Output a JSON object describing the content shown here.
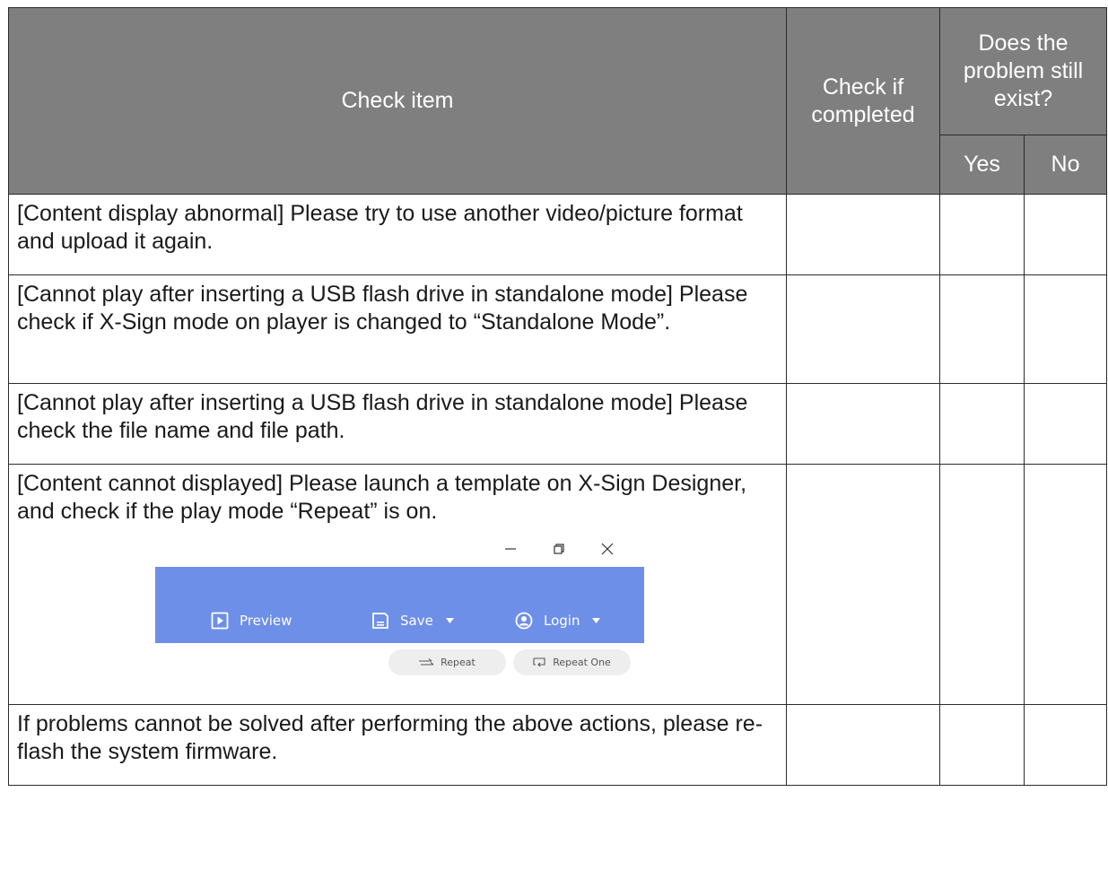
{
  "header": {
    "check_item": "Check item",
    "check_if_completed": "Check if completed",
    "problem_still_exist": "Does the problem still exist?",
    "yes": "Yes",
    "no": "No"
  },
  "rows": [
    {
      "text": "[Content display abnormal] Please try to use another video/picture format and upload it again."
    },
    {
      "text": "[Cannot play after inserting a USB flash drive in standalone mode] Please check if X-Sign mode on player is changed to “Standalone Mode”."
    },
    {
      "text": "[Cannot play after inserting a USB flash drive in standalone mode] Please check the file name and file path."
    },
    {
      "text": "[Content cannot displayed] Please launch a template on X-Sign Designer, and check if the play mode “Repeat” is on."
    },
    {
      "text": "If problems cannot be solved after performing the above actions, please re-flash the system firmware."
    }
  ],
  "screenshot": {
    "window_controls": [
      "minimize-icon",
      "restore-icon",
      "close-icon"
    ],
    "toolbar_color": "#6e8fe8",
    "toolbar": {
      "preview_label": "Preview",
      "save_label": "Save",
      "login_label": "Login"
    },
    "play_modes": {
      "repeat_label": "Repeat",
      "repeat_one_label": "Repeat One"
    }
  },
  "colors": {
    "header_bg": "#7f7f7f",
    "header_text": "#ffffff",
    "border": "#2b2b2b"
  }
}
